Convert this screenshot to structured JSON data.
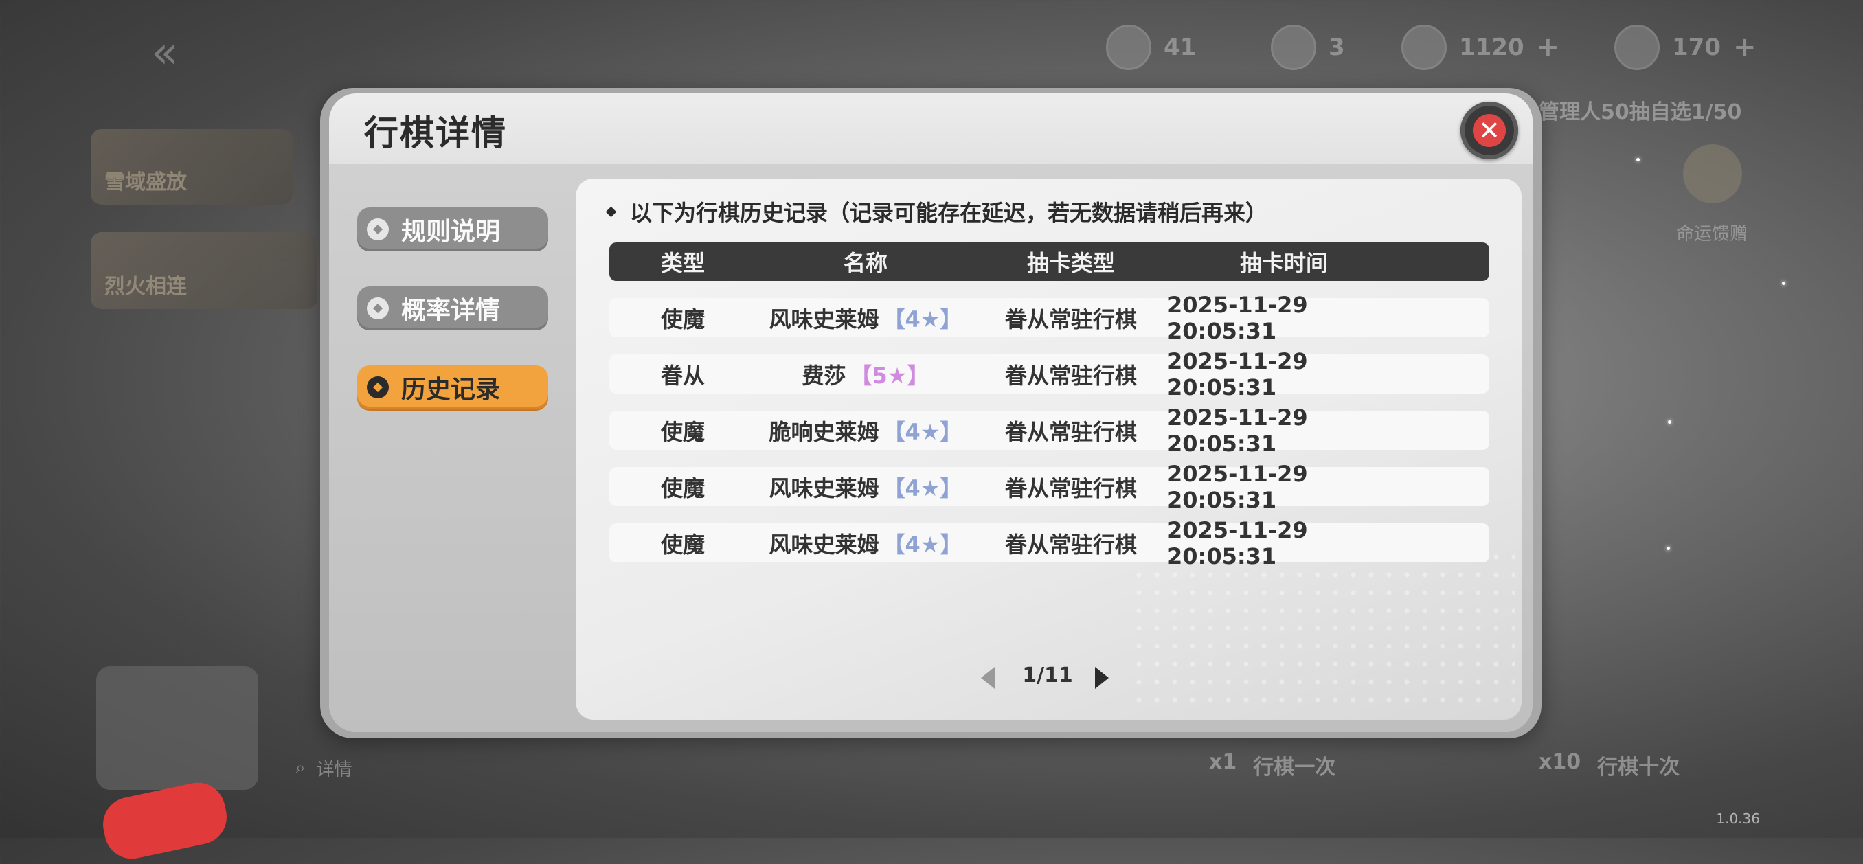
{
  "background": {
    "resources": [
      {
        "icon": "coin-icon",
        "value": "41"
      },
      {
        "icon": "ticket-icon",
        "value": "3"
      },
      {
        "icon": "crystal-icon",
        "value": "1120"
      },
      {
        "icon": "star-currency-icon",
        "value": "170"
      }
    ],
    "banner_cards": [
      "雪域盛放",
      "烈火相连"
    ],
    "top_right_text": "管理人50抽自选1/50",
    "fate_label": "命运馈赠",
    "footer_texts": [
      "详情",
      "行棋一次",
      "行棋十次"
    ],
    "footer_costs": [
      "x1",
      "x10"
    ],
    "version": "1.0.36"
  },
  "dialog": {
    "title": "行棋详情",
    "close_icon": "close-icon",
    "tabs": [
      {
        "label": "规则说明",
        "active": false
      },
      {
        "label": "概率详情",
        "active": false
      },
      {
        "label": "历史记录",
        "active": true
      }
    ],
    "notice": "以下为行棋历史记录（记录可能存在延迟，若无数据请稍后再来）",
    "table": {
      "headers": [
        "类型",
        "名称",
        "抽卡类型",
        "抽卡时间"
      ],
      "rows": [
        {
          "type": "使魔",
          "name": "风味史莱姆",
          "rarity": "【4★】",
          "draw_type": "眷从常驻行棋",
          "time": "2025-11-29 20:05:31"
        },
        {
          "type": "眷从",
          "name": "费莎",
          "rarity": "【5★】",
          "draw_type": "眷从常驻行棋",
          "time": "2025-11-29 20:05:31"
        },
        {
          "type": "使魔",
          "name": "脆响史莱姆",
          "rarity": "【4★】",
          "draw_type": "眷从常驻行棋",
          "time": "2025-11-29 20:05:31"
        },
        {
          "type": "使魔",
          "name": "风味史莱姆",
          "rarity": "【4★】",
          "draw_type": "眷从常驻行棋",
          "time": "2025-11-29 20:05:31"
        },
        {
          "type": "使魔",
          "name": "风味史莱姆",
          "rarity": "【4★】",
          "draw_type": "眷从常驻行棋",
          "time": "2025-11-29 20:05:31"
        }
      ]
    },
    "pagination": {
      "current": 1,
      "total": 11,
      "text": "1/11"
    },
    "colors": {
      "active_tab": "#f3a33e",
      "rarity4": "#8ea3d4",
      "rarity5": "#d08adf",
      "close": "#e04545"
    }
  }
}
